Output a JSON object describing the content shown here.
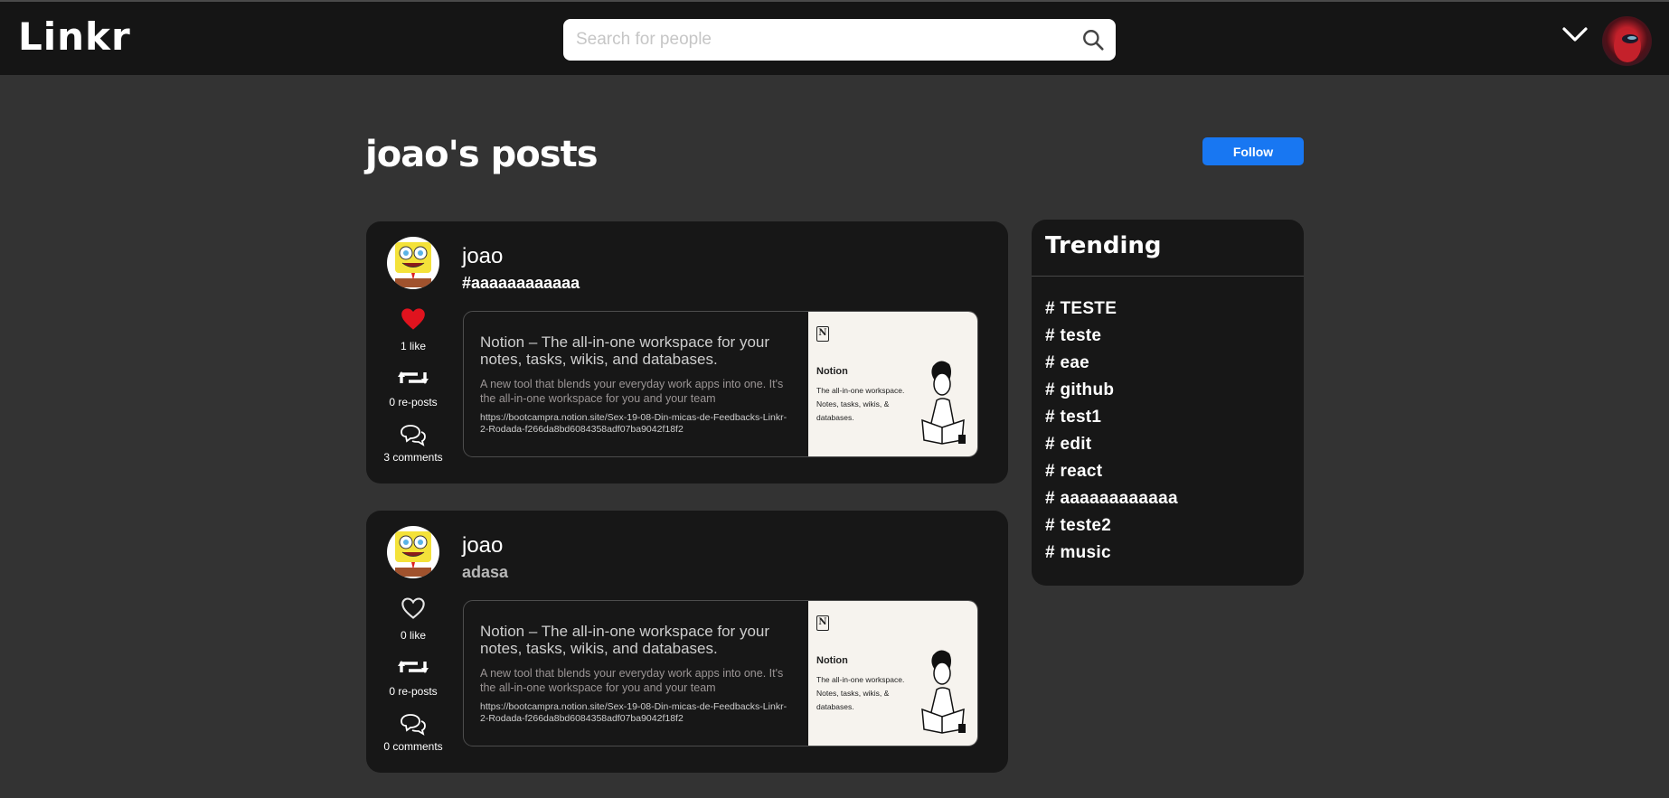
{
  "app": {
    "logo": "Linkr"
  },
  "search": {
    "placeholder": "Search for people"
  },
  "page": {
    "title": "joao's posts",
    "follow_label": "Follow"
  },
  "posts": [
    {
      "username": "joao",
      "text": "#aaaaaaaaaaaa",
      "liked": true,
      "likes_label": "1 like",
      "reposts_label": "0 re-posts",
      "comments_label": "3 comments",
      "link": {
        "title": "Notion – The all-in-one workspace for your notes, tasks, wikis, and databases.",
        "description": "A new tool that blends your everyday work apps into one. It's the all-in-one workspace for you and your team",
        "url": "https://bootcampra.notion.site/Sex-19-08-Din-micas-de-Feedbacks-Linkr-2-Rodada-f266da8bd6084358adf07ba9042f18f2",
        "image": {
          "brand": "Notion",
          "tagline1": "The all-in-one workspace.",
          "tagline2": "Notes, tasks, wikis, & databases."
        }
      }
    },
    {
      "username": "joao",
      "text": "adasa",
      "liked": false,
      "likes_label": "0 like",
      "reposts_label": "0 re-posts",
      "comments_label": "0 comments",
      "link": {
        "title": "Notion – The all-in-one workspace for your notes, tasks, wikis, and databases.",
        "description": "A new tool that blends your everyday work apps into one. It's the all-in-one workspace for you and your team",
        "url": "https://bootcampra.notion.site/Sex-19-08-Din-micas-de-Feedbacks-Linkr-2-Rodada-f266da8bd6084358adf07ba9042f18f2",
        "image": {
          "brand": "Notion",
          "tagline1": "The all-in-one workspace.",
          "tagline2": "Notes, tasks, wikis, & databases."
        }
      }
    }
  ],
  "trending": {
    "title": "Trending",
    "tags": [
      "# TESTE",
      "# teste",
      "# eae",
      "# github",
      "# test1",
      "# edit",
      "# react",
      "# aaaaaaaaaaaa",
      "# teste2",
      "# music"
    ]
  },
  "colors": {
    "like_active": "#e0131e",
    "follow_button": "#1877f2",
    "topbar": "#151515",
    "background": "#333333"
  }
}
